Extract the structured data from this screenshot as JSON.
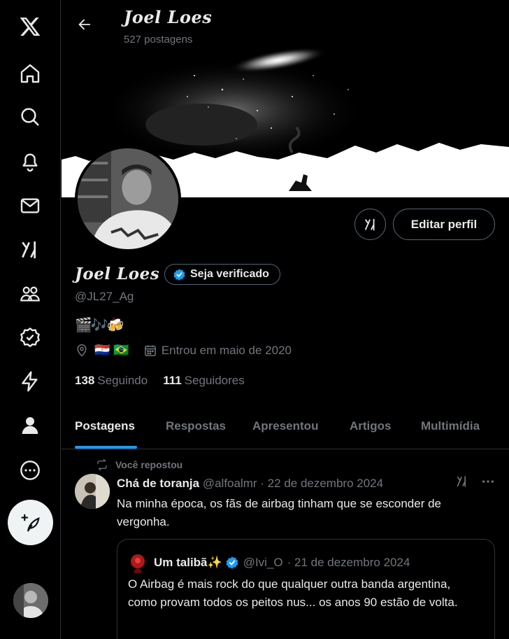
{
  "header": {
    "name": "Joel Loes",
    "post_count": "527 postagens"
  },
  "profile": {
    "name": "Joel Loes",
    "verify_label": "Seja verificado",
    "handle": "@JL27_Ag",
    "bio": "🎬🎶🍻",
    "location_flags": "🇵🇾 🇧🇷",
    "joined": "Entrou em maio de 2020",
    "following_count": "138",
    "following_label": "Seguindo",
    "followers_count": "111",
    "followers_label": "Seguidores",
    "edit_label": "Editar perfil"
  },
  "tabs": [
    {
      "label": "Postagens"
    },
    {
      "label": "Respostas"
    },
    {
      "label": "Apresentou"
    },
    {
      "label": "Artigos"
    },
    {
      "label": "Multimídia"
    }
  ],
  "post": {
    "repost_label": "Você repostou",
    "author": "Chá de toranja",
    "handle": "@alfoalmr",
    "date": "· 22 de dezembro 2024",
    "text": "Na minha época, os fãs de airbag tinham que se esconder de vergonha.",
    "quote": {
      "author": "Um talibã✨",
      "handle": "@Ivi_O",
      "date": "· 21 de dezembro 2024",
      "text": "O Airbag é mais rock do que qualquer outra banda argentina, como provam todos os peitos nus... os anos 90 estão de volta."
    }
  },
  "nav": {
    "icons": [
      "x-logo-icon",
      "home-icon",
      "search-icon",
      "notifications-icon",
      "messages-icon",
      "grok-icon",
      "communities-icon",
      "verified-icon",
      "lightning-icon",
      "profile-icon",
      "more-icon"
    ]
  },
  "colors": {
    "accent": "#1d9bf0",
    "text": "#e7e9ea",
    "muted": "#71767b",
    "border": "#2f3336"
  }
}
